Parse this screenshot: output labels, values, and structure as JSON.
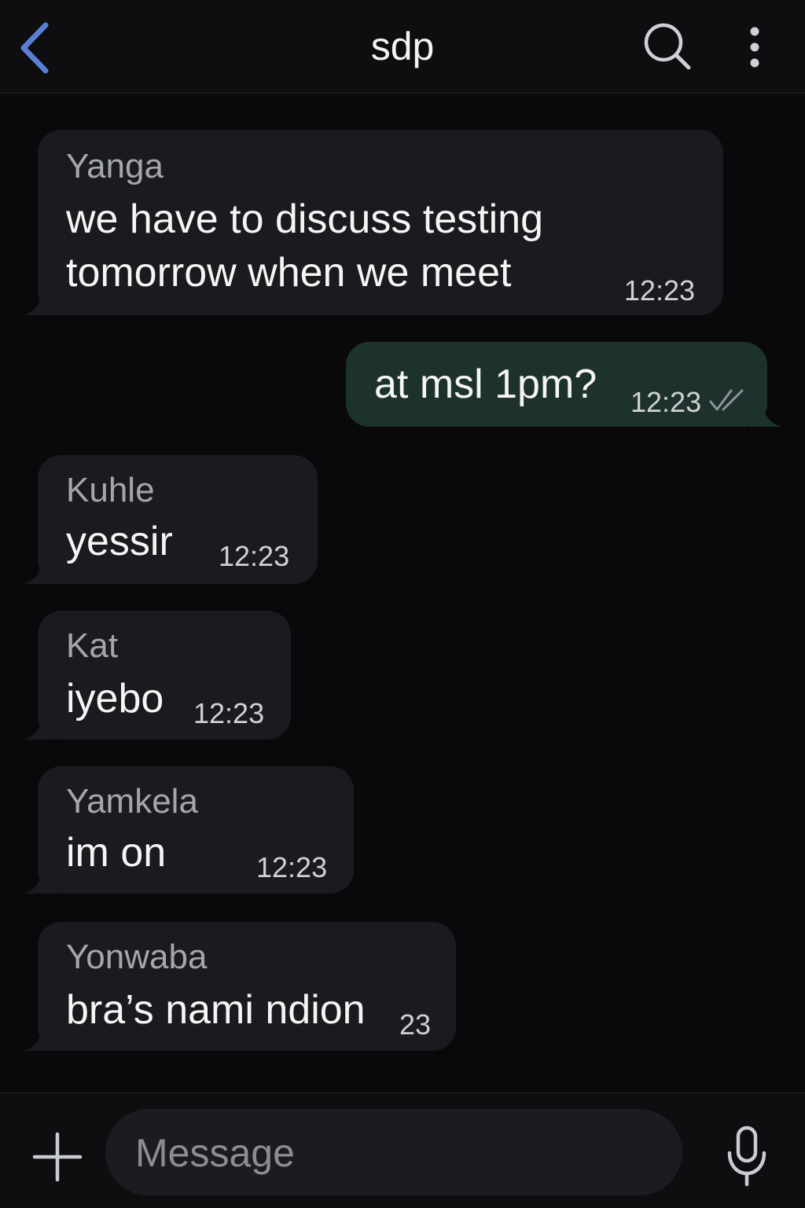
{
  "header": {
    "title": "sdp",
    "back_icon": "chevron-left-icon",
    "search_icon": "search-icon",
    "more_icon": "more-vertical-icon",
    "accent_color": "#5b7fd6"
  },
  "messages": [
    {
      "direction": "incoming",
      "sender": "Yanga",
      "lines": [
        "we have to discuss testing",
        "tomorrow when we meet"
      ],
      "time": "12:23"
    },
    {
      "direction": "outgoing",
      "text": "at msl 1pm?",
      "time": "12:23",
      "status_icon": "double-check-icon"
    },
    {
      "direction": "incoming",
      "sender": "Kuhle",
      "text": "yessir",
      "time": "12:23"
    },
    {
      "direction": "incoming",
      "sender": "Kat",
      "text": "iyebo",
      "time": "12:23"
    },
    {
      "direction": "incoming",
      "sender": "Yamkela",
      "text": "im on",
      "time": "12:23"
    },
    {
      "direction": "incoming",
      "sender": "Yonwaba",
      "text": "bra’s nami ndion",
      "time": "23"
    }
  ],
  "composer": {
    "placeholder": "Message",
    "value": "",
    "add_icon": "plus-icon",
    "mic_icon": "microphone-icon"
  },
  "colors": {
    "background": "#09090b",
    "incoming_bubble": "#1b1b1f",
    "outgoing_bubble": "#1d312d"
  }
}
